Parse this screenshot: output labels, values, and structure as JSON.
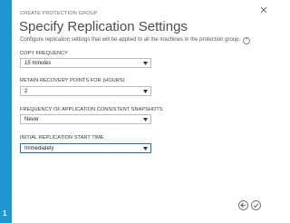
{
  "wizard": {
    "dialog_name": "CREATE PROTECTION GROUP",
    "title": "Specify Replication Settings",
    "subtitle": "Configure replication settings that will be applied to all the machines in the protection group.",
    "step_number": "1",
    "accent_color": "#1e96cf"
  },
  "fields": {
    "copy_frequency": {
      "label": "COPY FREQUENCY",
      "value": "15 minutes"
    },
    "retain_recovery_points": {
      "label": "RETAIN RECOVERY POINTS FOR (HOURS)",
      "value": "2"
    },
    "app_consistent_snapshots": {
      "label": "FREQUENCY OF APPLICATION CONSISTENT SNAPSHOTS",
      "value": "Never"
    },
    "initial_replication_start": {
      "label": "INITIAL REPLICATION START TIME",
      "value": "Immediately"
    }
  },
  "icons": {
    "close": "close-icon",
    "help": "help-icon",
    "dropdown": "chevron-down-icon",
    "back": "back-arrow-icon",
    "complete": "checkmark-icon"
  }
}
